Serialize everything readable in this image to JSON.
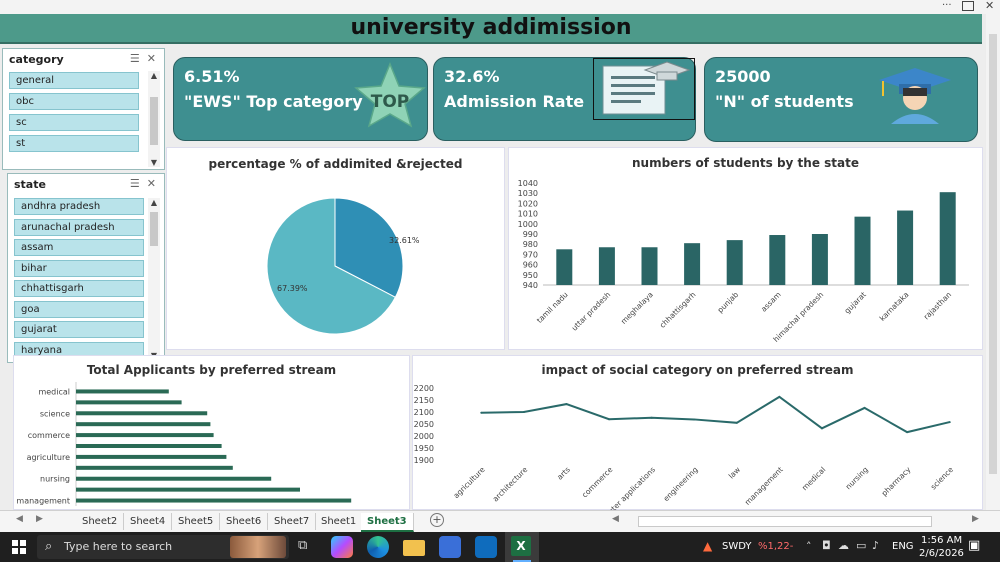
{
  "title": "university addimission",
  "slicers": {
    "category": {
      "header": "category",
      "items": [
        "general",
        "obc",
        "sc",
        "st"
      ]
    },
    "state": {
      "header": "state",
      "items": [
        "andhra pradesh",
        "arunachal pradesh",
        "assam",
        "bihar",
        "chhattisgarh",
        "goa",
        "gujarat",
        "haryana"
      ]
    }
  },
  "kpis": [
    {
      "value": "6.51%",
      "label": "\"EWS\" Top category",
      "badge": "TOP"
    },
    {
      "value": "32.6%",
      "label": "Admission Rate"
    },
    {
      "value": "25000",
      "label": "\"N\" of students"
    }
  ],
  "chart_data": [
    {
      "type": "pie",
      "title": "percentage % of addimited &rejected",
      "labels": [
        "32.61%",
        "67.39%"
      ],
      "values": [
        32.61,
        67.39
      ],
      "colors": [
        "#2f8fb5",
        "#5ab8c4"
      ]
    },
    {
      "type": "bar",
      "title": "numbers of students by the state",
      "categories": [
        "tamil nadu",
        "uttar pradesh",
        "meghalaya",
        "chhattisgarh",
        "punjab",
        "assam",
        "himachal pradesh",
        "gujarat",
        "karnataka",
        "rajasthan"
      ],
      "values": [
        975,
        977,
        977,
        981,
        984,
        989,
        990,
        1007,
        1013,
        1031
      ],
      "ylim": [
        940,
        1040
      ],
      "yticks": [
        940,
        950,
        960,
        970,
        980,
        990,
        1000,
        1010,
        1020,
        1030,
        1040
      ],
      "color": "#2a6565"
    },
    {
      "type": "bar",
      "orientation": "horizontal",
      "title": "Total Applicants by preferred stream",
      "categories": [
        "management",
        "",
        "nursing",
        "",
        "agriculture",
        "",
        "commerce",
        "",
        "science",
        "",
        "medical"
      ],
      "values": [
        2162,
        2130,
        2112,
        2088,
        2084,
        2081,
        2076,
        2074,
        2072,
        2056,
        2048
      ],
      "xlim": [
        1990,
        2190
      ],
      "color": "#2a6a55"
    },
    {
      "type": "line",
      "title": "impact of social category on preferred stream",
      "categories": [
        "agriculture",
        "architecture",
        "arts",
        "commerce",
        "puter applications",
        "engineering",
        "law",
        "management",
        "medical",
        "nursing",
        "pharmacy",
        "science"
      ],
      "values": [
        2097,
        2100,
        2133,
        2070,
        2076,
        2069,
        2055,
        2163,
        2032,
        2117,
        2016,
        2058
      ],
      "ylim": [
        1900,
        2200
      ],
      "yticks": [
        1900,
        1950,
        2000,
        2050,
        2100,
        2150,
        2200
      ],
      "color": "#2a6a6a"
    }
  ],
  "tabs": [
    "Sheet2",
    "Sheet4",
    "Sheet5",
    "Sheet6",
    "Sheet7",
    "Sheet1",
    "Sheet3"
  ],
  "active_tab": "Sheet3",
  "taskbar": {
    "search_placeholder": "Type here to search",
    "stock_ticker": "SWDY",
    "stock_change": "%1,22-",
    "lang": "ENG",
    "time": "1:56 AM",
    "date": "2/6/2026"
  }
}
